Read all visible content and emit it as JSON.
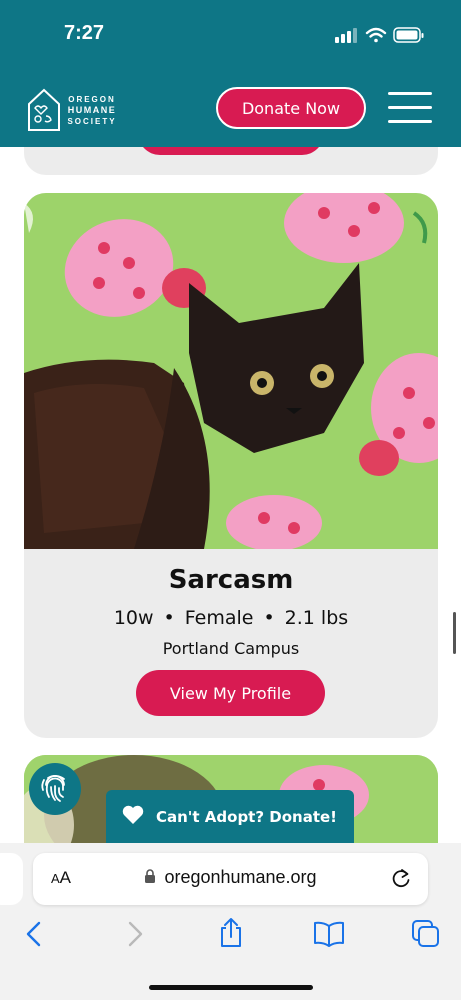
{
  "status_bar": {
    "time": "7:27"
  },
  "header": {
    "logo_line1": "OREGON",
    "logo_line2": "HUMANE",
    "logo_line3": "SOCIETY",
    "donate_label": "Donate Now"
  },
  "pet": {
    "name": "Sarcasm",
    "age": "10w",
    "sex": "Female",
    "weight": "2.1 lbs",
    "separator": "•",
    "location": "Portland Campus",
    "profile_button": "View My Profile"
  },
  "floating": {
    "cant_adopt_label": "Can't Adopt? Donate!"
  },
  "browser": {
    "text_size_label_small": "A",
    "text_size_label_large": "A",
    "url": "oregonhumane.org"
  },
  "colors": {
    "teal": "#0e7686",
    "accent": "#d81b52",
    "card_bg": "#ececec"
  },
  "icons": {
    "status": [
      "cellular-signal-icon",
      "wifi-icon",
      "battery-icon"
    ],
    "toolbar": [
      "back-icon",
      "forward-icon",
      "share-icon",
      "bookmarks-icon",
      "tabs-icon"
    ]
  }
}
